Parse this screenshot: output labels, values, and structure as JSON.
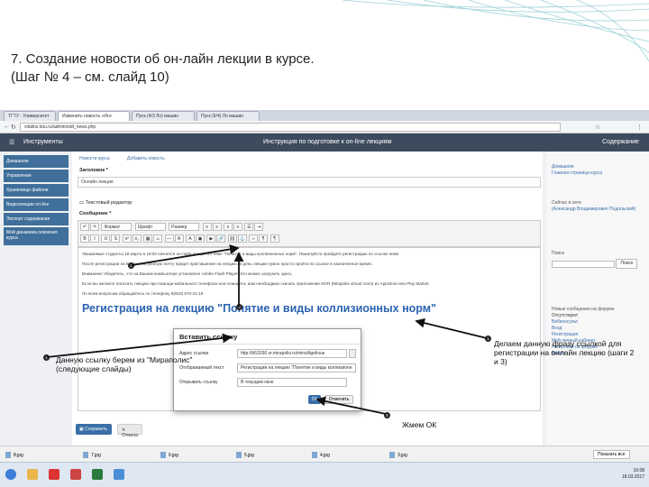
{
  "slide": {
    "title_line1": "7. Создание новости об он-лайн лекции в курсе.",
    "title_line2": "(Шаг № 4 – см. слайд 10)"
  },
  "browser": {
    "tabs": [
      "ТГТУ - Университет",
      "Изменить новость «Ин»",
      "Пуск (4/3 Ло) машин",
      "Пуск (6/4) Ло машин"
    ],
    "address": "vitalins.tstu.ru/admin/edit_news.php",
    "app_left": "Инструменты",
    "app_center": "Инструкция по подготовке к on-line лекциям",
    "app_right": "Содержание"
  },
  "sidebar": {
    "items": [
      "Домашняя",
      "Управление",
      "Хранилище файлов",
      "Видеолекции on-line",
      "Экспорт содержания",
      "Мой динамика освоения курса"
    ]
  },
  "form": {
    "crumbs": [
      "Новости курса",
      "Добавить новость"
    ],
    "title_label": "Заголовок *",
    "title_value": "Онлайн лекция",
    "editor_label": "Текстовый редактор",
    "message_label": "Сообщение *",
    "toolbar_format": "Формат",
    "toolbar_font": "Шрифт",
    "toolbar_size": "Размер",
    "body_lines": [
      "Уважаемые студенты 18 марта в 18:00 начнется он-лайн лекция по теме \"Понятие и виды коллизионных норм\". Пожалуйста пройдите регистрацию по ссылке ниже",
      "После регистрации на Вашу электронную почту придет приглашение на лекцию. В день лекции нужно просто пройти по ссылке в назначенное время.",
      "Внимание! Убедитесь, что на Вашем компьютере установлен Adobe Flash Player. Это можно загрузить здесь",
      "Если вы желаете посетить лекцию при помощи мобильного телефона или планшета, вам необходимо скачать приложение MVR (Mirapolis virtual room) из AppStore или Play Market.",
      "По всем вопросам обращайтесь по телефону 8(910) 870-24-19"
    ],
    "big_link": "Регистрация на лекцию \"Понятие и виды коллизионных норм\"",
    "save_label": "Сохранить",
    "cancel_label": "Отмена"
  },
  "right": {
    "b1_title": "Домашняя",
    "b1_link": "Главная страница курса",
    "b2_title": "Сейчас в сети",
    "b2_user": "(Александр Владимирович Подольский)",
    "b3_title": "Поиск",
    "b3_btn": "Поиск",
    "b4_title": "Новые сообщения на форуме",
    "b4_lines": [
      "Отсутствуют",
      "Вебконсульт",
      "Вход",
      "Регистрация",
      "Мой личный кабинет",
      "Настройки на форуме",
      "Выйти"
    ]
  },
  "dialog": {
    "title": "Вставить ссылку",
    "url_label": "Адрес ссылки",
    "url_value": "http://b52030.vr.mirapolis.ru/mira/Agelious",
    "text_label": "Отображаемый текст",
    "text_value": "Регистрация на лекцию \"Понятие и виды коллизионн",
    "open_label": "Открывать ссылку",
    "open_value": "В текущем окне",
    "ok": "Ok",
    "cancel": "Отменить"
  },
  "downloads": {
    "files": [
      "8.jpg",
      "7.jpg",
      "6.jpg",
      "5.jpg",
      "4.jpg",
      "3.jpg"
    ],
    "show_all": "Показать все"
  },
  "clock": {
    "time": "16:08",
    "date": "18.03.2017"
  },
  "annotations": {
    "a1": "Делаем данную фразу ссылкой для регистрации на онлайн лекцию (шаги 2 и 3)",
    "a2_line1": "Данную ссылку берем из \"Мираполис\"",
    "a2_line2": "(следующие слайды)",
    "a3": "Жмем ОК",
    "badges": [
      "1",
      "2",
      "3",
      "4",
      "5"
    ]
  }
}
